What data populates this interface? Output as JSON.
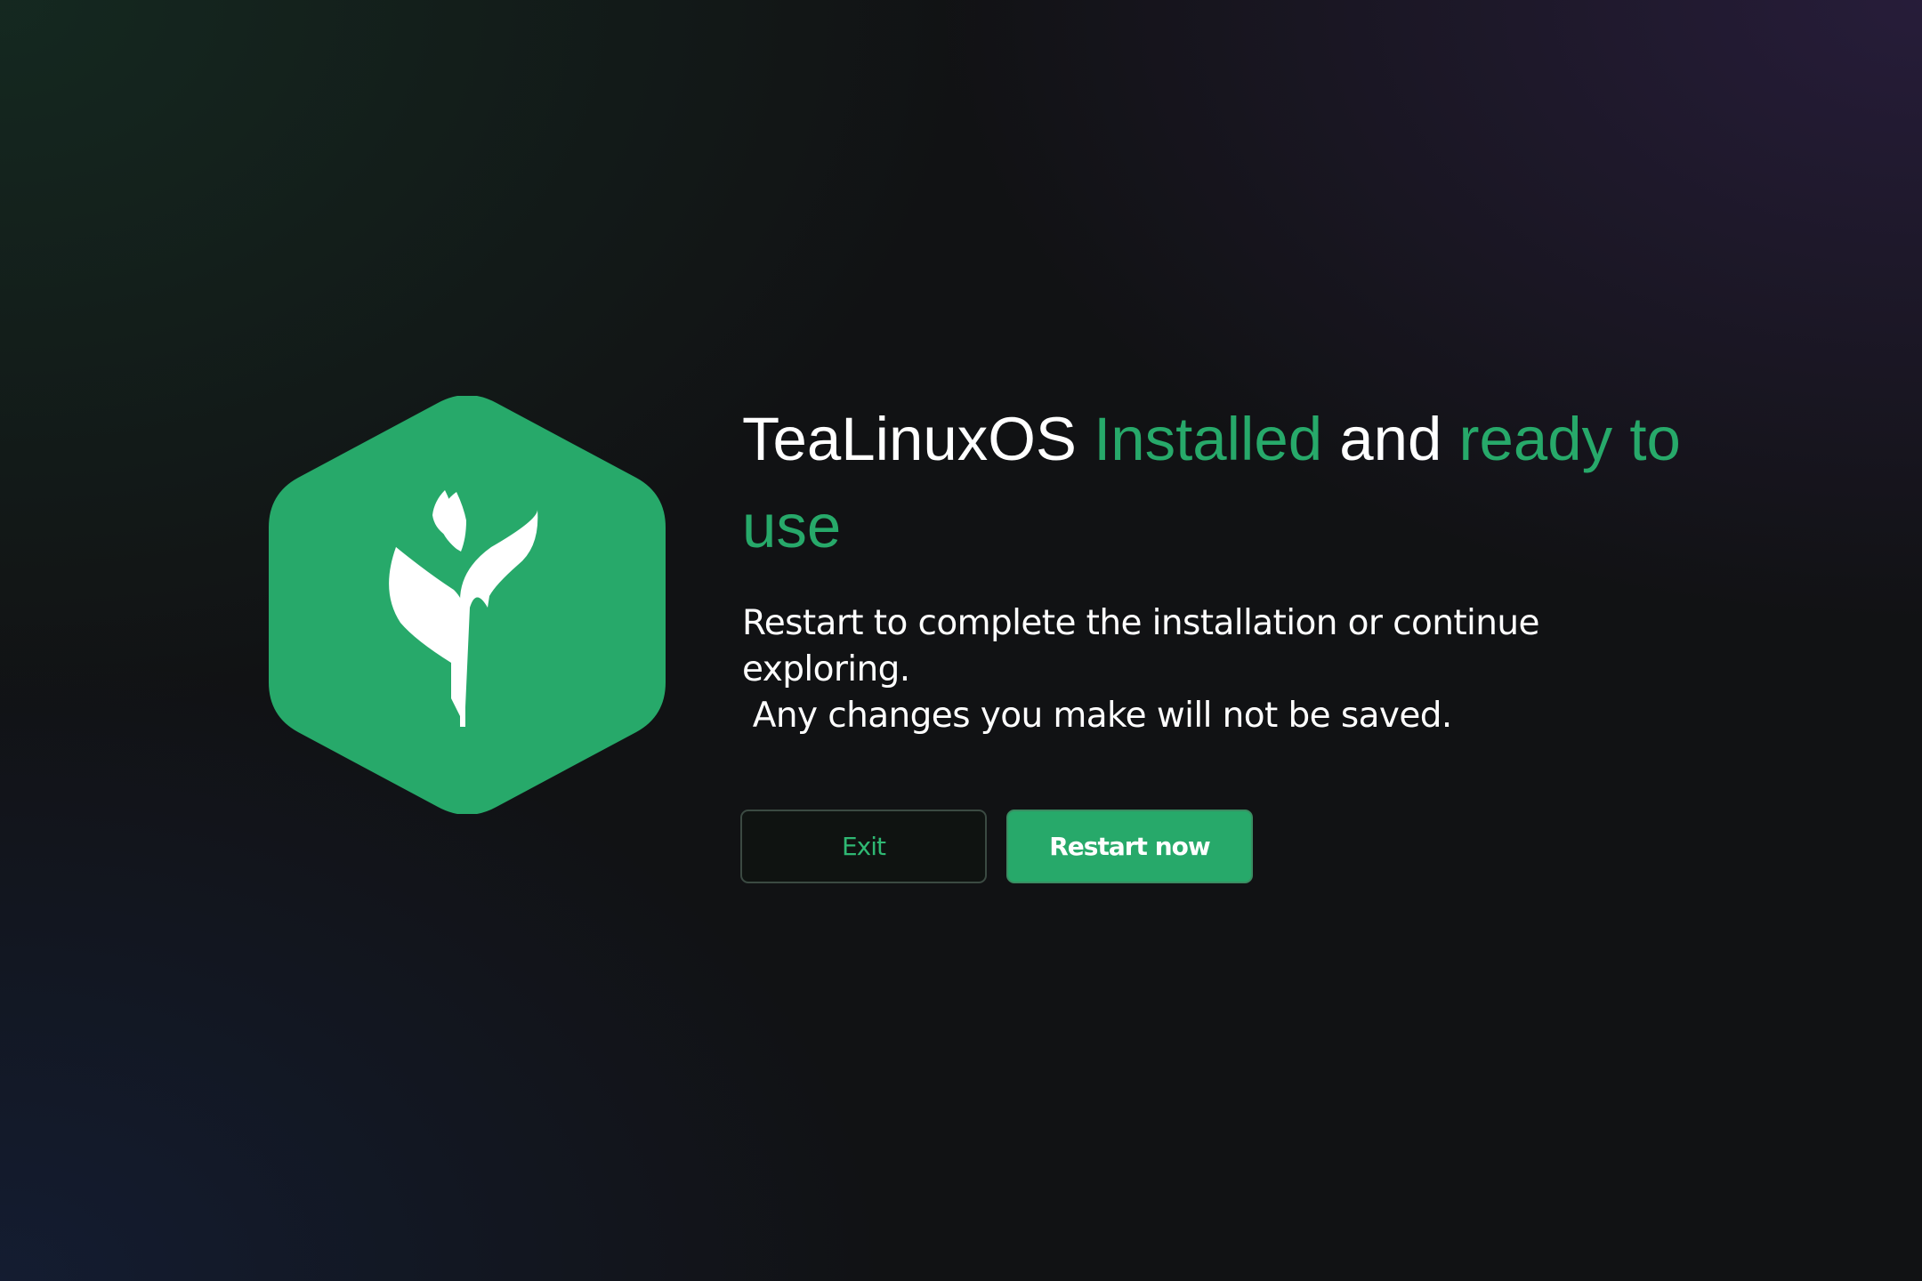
{
  "title": {
    "part1": "TeaLinuxOS",
    "part2": "Installed",
    "part3": "and",
    "part4": "ready to use"
  },
  "subtitle": {
    "line1": "Restart to complete the installation or continue",
    "line2": "exploring.",
    "line3": " Any changes you make will not be saved."
  },
  "buttons": {
    "exit_label": "Exit",
    "restart_label": "Restart now"
  },
  "logo": {
    "icon": "tea-leaf-hexagon-icon"
  },
  "colors": {
    "accent": "#27a96a",
    "text": "#ffffff",
    "background": "#111214"
  }
}
